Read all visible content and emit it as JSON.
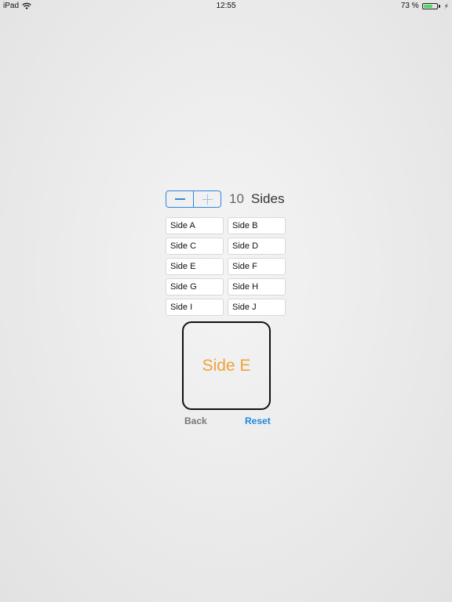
{
  "status_bar": {
    "device": "iPad",
    "time": "12:55",
    "battery": "73 %",
    "battery_level": 0.73,
    "battery_color": "#4cd964"
  },
  "stepper": {
    "minus_icon": "minus-icon",
    "plus_icon": "plus-icon",
    "count": "10",
    "label": "Sides",
    "accent": "#2f86df"
  },
  "sides": [
    {
      "label": "Side A"
    },
    {
      "label": "Side B"
    },
    {
      "label": "Side C"
    },
    {
      "label": "Side D"
    },
    {
      "label": "Side E"
    },
    {
      "label": "Side F"
    },
    {
      "label": "Side G"
    },
    {
      "label": "Side H"
    },
    {
      "label": "Side I"
    },
    {
      "label": "Side J"
    }
  ],
  "display": {
    "text": "Side E",
    "color": "#f0a23a"
  },
  "actions": {
    "back_label": "Back",
    "reset_label": "Reset",
    "reset_color": "#1f88de"
  }
}
